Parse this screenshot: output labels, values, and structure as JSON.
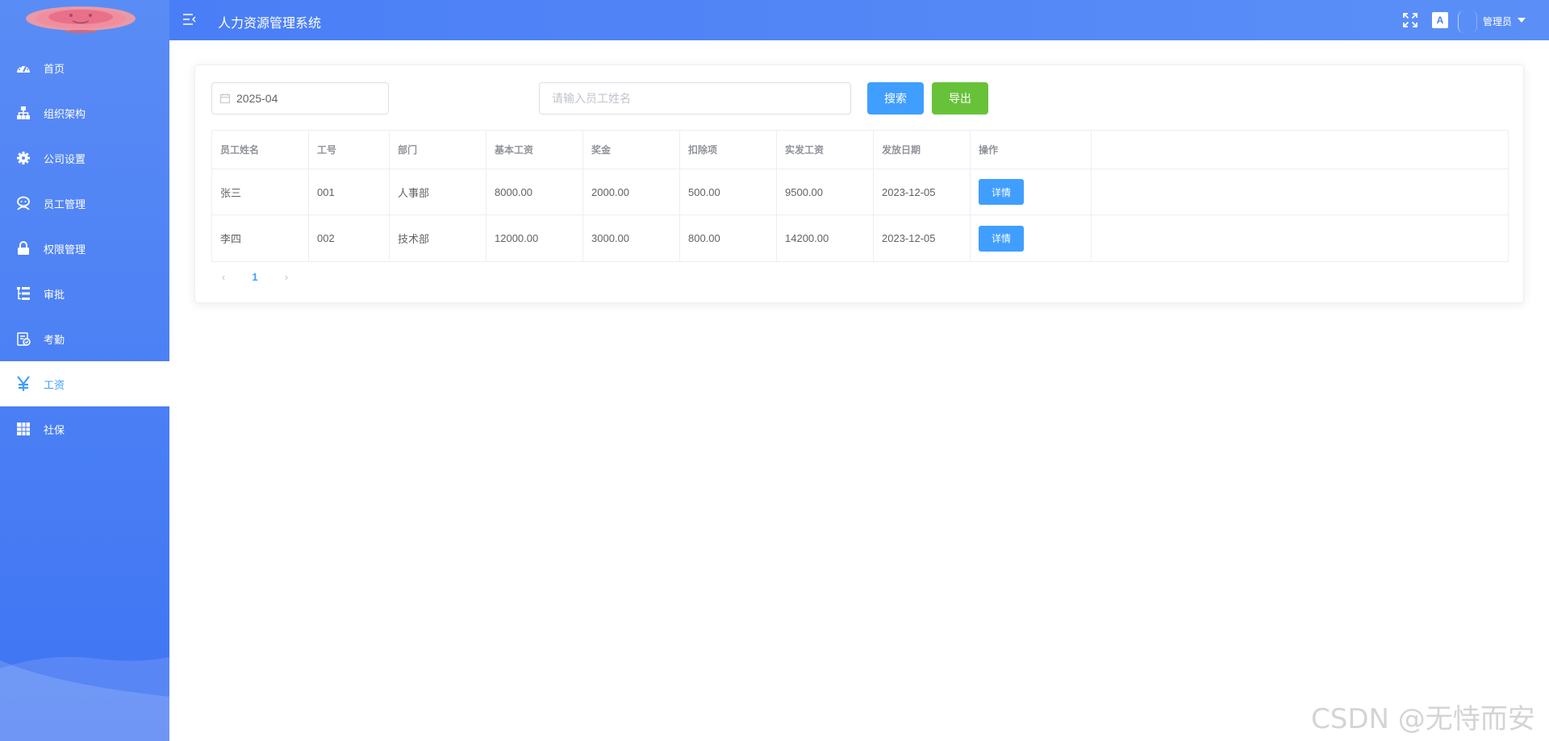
{
  "header": {
    "title": "人力资源管理系统",
    "user_name": "管理员",
    "lang_badge": "A",
    "icons": [
      "menu-fold-icon",
      "fullscreen-icon",
      "language-icon",
      "avatar",
      "caret-down-icon"
    ]
  },
  "sidebar": {
    "items": [
      {
        "label": "首页",
        "icon": "dashboard-icon"
      },
      {
        "label": "组织架构",
        "icon": "tree-icon"
      },
      {
        "label": "公司设置",
        "icon": "gear-icon"
      },
      {
        "label": "员工管理",
        "icon": "people-icon"
      },
      {
        "label": "权限管理",
        "icon": "lock-icon"
      },
      {
        "label": "审批",
        "icon": "tree-table-icon"
      },
      {
        "label": "考勤",
        "icon": "clipboard-icon"
      },
      {
        "label": "工资",
        "icon": "yen-icon",
        "active": true
      },
      {
        "label": "社保",
        "icon": "table-icon"
      }
    ]
  },
  "filters": {
    "month": "2025-04",
    "search_placeholder": "请输入员工姓名",
    "search_value": "",
    "search_button": "搜索",
    "export_button": "导出"
  },
  "table": {
    "columns": [
      "员工姓名",
      "工号",
      "部门",
      "基本工资",
      "奖金",
      "扣除项",
      "实发工资",
      "发放日期",
      "操作"
    ],
    "rows": [
      {
        "name": "张三",
        "id": "001",
        "dept": "人事部",
        "base": "8000.00",
        "bonus": "2000.00",
        "deduction": "500.00",
        "net": "9500.00",
        "date": "2023-12-05",
        "action": "详情"
      },
      {
        "name": "李四",
        "id": "002",
        "dept": "技术部",
        "base": "12000.00",
        "bonus": "3000.00",
        "deduction": "800.00",
        "net": "14200.00",
        "date": "2023-12-05",
        "action": "详情"
      }
    ]
  },
  "pagination": {
    "current": "1",
    "prev": "‹",
    "next": "›"
  },
  "watermark": "CSDN @无恃而安",
  "colors": {
    "primary": "#409eff",
    "success": "#67c23a",
    "sidebar": "#4a7ff5"
  }
}
